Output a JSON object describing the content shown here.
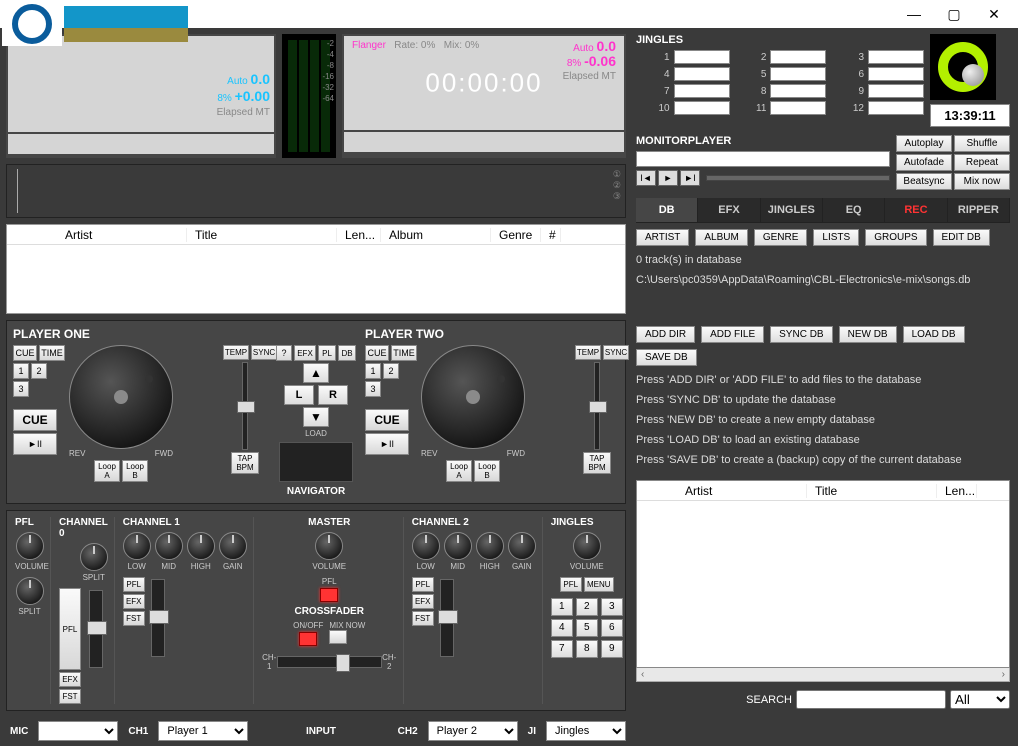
{
  "titlebar": {
    "min": "—",
    "max": "▢",
    "close": "✕"
  },
  "deck_left": {
    "auto": "Auto",
    "auto_val": "0.0",
    "pct": "8%",
    "pct_val": "+0.00",
    "elapsed": "Elapsed",
    "mt": "MT"
  },
  "deck_right": {
    "flanger": "Flanger",
    "rate": "Rate: 0%",
    "mix": "Mix: 0%",
    "auto": "Auto",
    "auto_val": "0.0",
    "pct": "8%",
    "pct_val": "-0.06",
    "time": "00:00:00",
    "elapsed": "Elapsed",
    "mt": "MT"
  },
  "tracklist_cols": {
    "artist": "Artist",
    "title": "Title",
    "len": "Len...",
    "album": "Album",
    "genre": "Genre",
    "num": "#"
  },
  "player1": {
    "label": "PLAYER ONE",
    "cue": "CUE",
    "time": "TIME",
    "b1": "1",
    "b2": "2",
    "b3": "3",
    "cue_btn": "CUE",
    "play": "►II",
    "rev": "REV",
    "fwd": "FWD",
    "loopA": "Loop\nA",
    "loopB": "Loop\nB",
    "temp": "TEMP",
    "sync": "SYNC",
    "tap": "TAP\nBPM"
  },
  "navigator": {
    "q": "?",
    "efx": "EFX",
    "pl": "PL",
    "db": "DB",
    "l": "L",
    "r": "R",
    "load": "LOAD",
    "label": "NAVIGATOR"
  },
  "player2": {
    "label": "PLAYER TWO",
    "cue": "CUE",
    "time": "TIME",
    "b1": "1",
    "b2": "2",
    "b3": "3",
    "cue_btn": "CUE",
    "play": "►II",
    "rev": "REV",
    "fwd": "FWD",
    "loopA": "Loop\nA",
    "loopB": "Loop\nB",
    "temp": "TEMP",
    "sync": "SYNC",
    "tap": "TAP\nBPM"
  },
  "mixer": {
    "pfl": "PFL",
    "volume": "VOLUME",
    "split": "SPLIT",
    "ch0": "CHANNEL 0",
    "ch1": "CHANNEL 1",
    "ch2": "CHANNEL 2",
    "master": "MASTER",
    "jingles": "JINGLES",
    "low": "LOW",
    "mid": "MID",
    "high": "HIGH",
    "gain": "GAIN",
    "efx": "EFX",
    "fst": "FST",
    "crossfader": "CROSSFADER",
    "onoff": "ON/OFF",
    "mixnow": "MIX NOW",
    "chm1": "CH-1",
    "chm2": "CH-2",
    "menu": "MENU"
  },
  "bottombar": {
    "mic": "MIC",
    "ch1": "CH1",
    "ch1_val": "Player 1",
    "input": "INPUT",
    "ch2": "CH2",
    "ch2_val": "Player 2",
    "ji": "JI",
    "ji_val": "Jingles"
  },
  "jingles": {
    "header": "JINGLES",
    "nums": [
      "1",
      "2",
      "3",
      "4",
      "5",
      "6",
      "7",
      "8",
      "9",
      "10",
      "11",
      "12"
    ]
  },
  "clock": "13:39:11",
  "monitor": {
    "header": "MONITORPLAYER"
  },
  "modes": {
    "autoplay": "Autoplay",
    "shuffle": "Shuffle",
    "autofade": "Autofade",
    "repeat": "Repeat",
    "beatsync": "Beatsync",
    "mixnow": "Mix now"
  },
  "tabs": {
    "db": "DB",
    "efx": "EFX",
    "jingles": "JINGLES",
    "eq": "EQ",
    "rec": "REC",
    "ripper": "RIPPER"
  },
  "db_filter": {
    "artist": "ARTIST",
    "album": "ALBUM",
    "genre": "GENRE",
    "lists": "LISTS",
    "groups": "GROUPS",
    "edit": "EDIT DB"
  },
  "db_status": {
    "count": "0 track(s) in database",
    "path": "C:\\Users\\pc0359\\AppData\\Roaming\\CBL-Electronics\\e-mix\\songs.db"
  },
  "db_ops": {
    "adddir": "ADD DIR",
    "addfile": "ADD FILE",
    "syncdb": "SYNC DB",
    "newdb": "NEW DB",
    "loaddb": "LOAD DB",
    "savedb": "SAVE DB"
  },
  "db_help": {
    "l1": "Press 'ADD DIR' or 'ADD FILE' to add files to the database",
    "l2": "Press 'SYNC DB' to update the database",
    "l3": "Press 'NEW DB' to create a new empty database",
    "l4": "Press 'LOAD DB' to load an existing database",
    "l5": "Press 'SAVE DB' to create a (backup) copy of the current database"
  },
  "db_table_cols": {
    "artist": "Artist",
    "title": "Title",
    "len": "Len..."
  },
  "search": {
    "label": "SEARCH",
    "all": "All"
  }
}
